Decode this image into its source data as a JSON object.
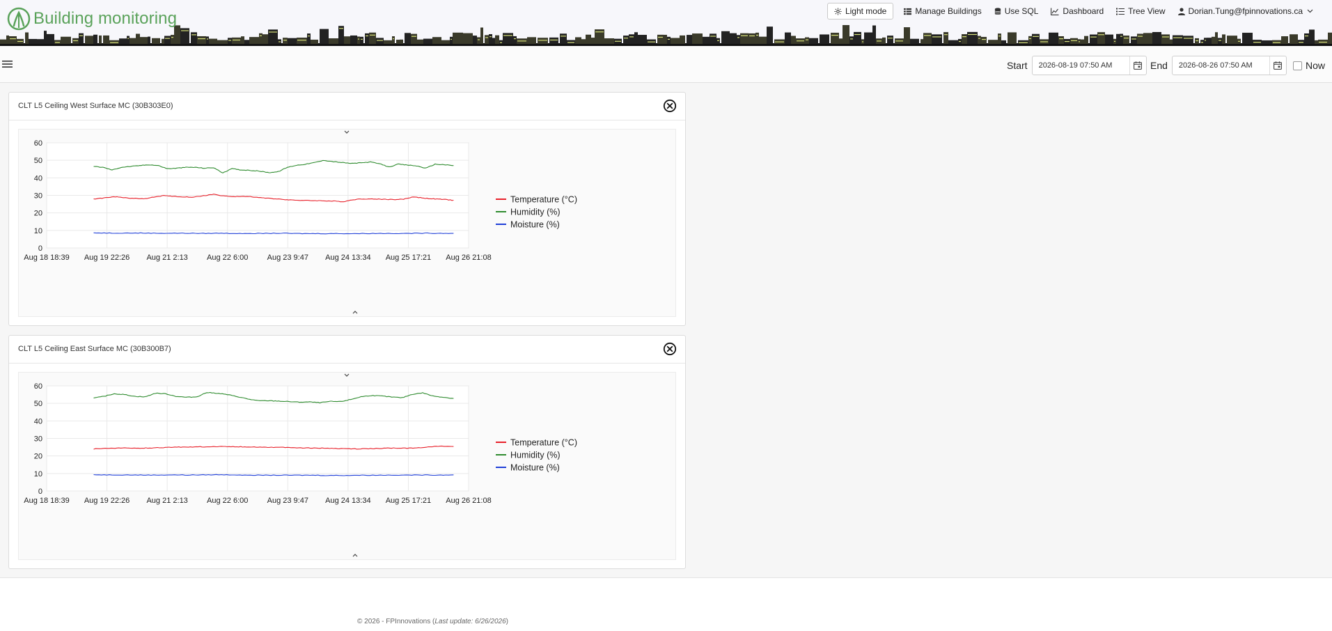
{
  "app": {
    "title": "Building monitoring",
    "brand_color": "#5aa25a"
  },
  "nav": {
    "items": [
      {
        "label": "Light mode",
        "icon": "sun-icon"
      },
      {
        "label": "Manage Buildings",
        "icon": "table-icon"
      },
      {
        "label": "Use SQL",
        "icon": "database-icon"
      },
      {
        "label": "Dashboard",
        "icon": "chart-line-icon"
      },
      {
        "label": "Tree View",
        "icon": "list-icon"
      },
      {
        "label": "Dorian.Tung@fpinnovations.ca",
        "icon": "user-icon"
      }
    ]
  },
  "toolbar": {
    "start_label": "Start",
    "start_value": "2026-08-19 07:50 AM",
    "end_label": "End",
    "end_value": "2026-08-26 07:50 AM",
    "now_label": "Now",
    "now_checked": false
  },
  "panels": [
    {
      "title": "CLT L5 Ceiling West Surface MC (30B303E0)",
      "chart_data": {
        "type": "line",
        "x_ticks": [
          "Aug 18 18:39",
          "Aug 19 22:26",
          "Aug 21 2:13",
          "Aug 22 6:00",
          "Aug 23 9:47",
          "Aug 24 13:34",
          "Aug 25 17:21",
          "Aug 26 21:08"
        ],
        "ylim": [
          0,
          60
        ],
        "y_ticks": [
          0,
          10,
          20,
          30,
          40,
          50,
          60
        ],
        "grid": true,
        "legend": "right",
        "x_start": "2026-08-19 07:50",
        "x_end": "2026-08-26 07:50",
        "series": [
          {
            "name": "Temperature (°C)",
            "color": "#e8202a",
            "values": [
              28,
              28.5,
              29.3,
              28.7,
              28.3,
              28,
              29,
              29.8,
              29.4,
              29.2,
              29,
              29.8,
              30.6,
              29.7,
              29.2,
              29.5,
              29.1,
              28.5,
              28.1,
              27.7,
              27.3,
              27.1,
              27,
              26.9,
              26.7,
              26.4,
              27.6,
              28,
              27.9,
              27.8,
              27.6,
              27.8,
              29.2,
              28.4,
              28,
              27.7,
              27.2
            ]
          },
          {
            "name": "Humidity (%)",
            "color": "#2e8b2e",
            "values": [
              46.5,
              46,
              44.5,
              46,
              46.5,
              47,
              47.5,
              47,
              45.2,
              45.5,
              46,
              46,
              45.5,
              45.8,
              42.8,
              45.2,
              44.5,
              44.2,
              43.8,
              43,
              43.5,
              46,
              47.2,
              47.8,
              48.8,
              50,
              49.2,
              48.7,
              48.2,
              48.6,
              49,
              48,
              46.2,
              47.8,
              47.3,
              46.8,
              45.5,
              47.8,
              47.5,
              47
            ]
          },
          {
            "name": "Moisture (%)",
            "color": "#1f3fd8",
            "values": [
              8.6,
              8.5,
              8.5,
              8.5,
              8.4,
              8.4,
              8.4,
              8.3,
              8.4,
              8.3,
              8.3,
              8.3,
              8.4,
              8.2,
              8.2,
              8.2,
              8.2,
              8.2,
              8.3,
              8.3,
              8.3,
              8.4,
              8.4,
              8.3
            ]
          }
        ]
      }
    },
    {
      "title": "CLT L5 Ceiling East Surface MC (30B300B7)",
      "chart_data": {
        "type": "line",
        "x_ticks": [
          "Aug 18 18:39",
          "Aug 19 22:26",
          "Aug 21 2:13",
          "Aug 22 6:00",
          "Aug 23 9:47",
          "Aug 24 13:34",
          "Aug 25 17:21",
          "Aug 26 21:08"
        ],
        "ylim": [
          0,
          60
        ],
        "y_ticks": [
          0,
          10,
          20,
          30,
          40,
          50,
          60
        ],
        "grid": true,
        "legend": "right",
        "x_start": "2026-08-19 07:50",
        "x_end": "2026-08-26 07:50",
        "series": [
          {
            "name": "Temperature (°C)",
            "color": "#e8202a",
            "values": [
              24,
              24.3,
              24.5,
              24.5,
              24.4,
              24.6,
              24.8,
              25,
              25.1,
              25.2,
              25.3,
              25.4,
              25.3,
              25.2,
              25.1,
              25,
              24.9,
              24.8,
              24.6,
              24.5,
              24.4,
              24.2,
              24.1,
              24,
              24.2,
              24.4,
              24.5,
              24.4,
              24.7,
              25.3,
              25.5,
              25.4
            ]
          },
          {
            "name": "Humidity (%)",
            "color": "#2e8b2e",
            "values": [
              53,
              54,
              55.5,
              55,
              54,
              53.7,
              55.8,
              55.5,
              54,
              53.5,
              53.7,
              56.2,
              55.8,
              55,
              53.8,
              52.5,
              51.5,
              51.5,
              51.3,
              51,
              50.7,
              50.8,
              50.4,
              51.1,
              51,
              52.2,
              53.8,
              54.5,
              54.2,
              53.6,
              53.2,
              55.2,
              56,
              54.2,
              53.5,
              52.8
            ]
          },
          {
            "name": "Moisture (%)",
            "color": "#1f3fd8",
            "values": [
              9.3,
              9.2,
              9.2,
              9.1,
              9.1,
              9.2,
              9.1,
              9.2,
              9.3,
              9.2,
              9.1,
              9,
              9,
              9,
              9,
              8.9,
              8.9,
              9,
              9,
              9.1,
              9.1,
              9.1,
              9.1,
              9.2
            ]
          }
        ]
      }
    }
  ],
  "footer": {
    "copyright": "© 2026 - FPInnovations (",
    "last_update": "Last update: 6/26/2026",
    "close_paren": ")"
  }
}
